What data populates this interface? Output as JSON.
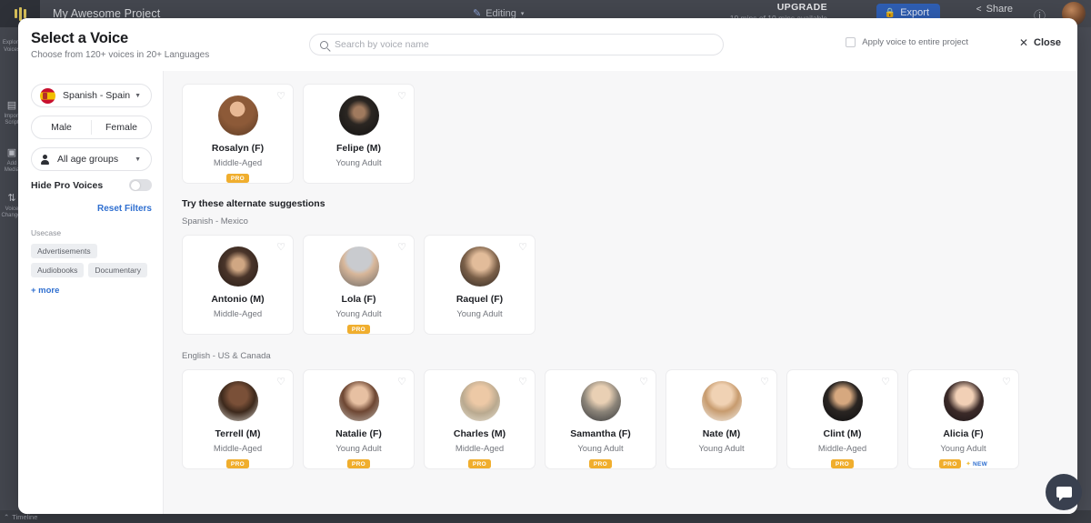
{
  "app": {
    "project_title": "My Awesome Project",
    "editing_label": "Editing",
    "upgrade_label": "UPGRADE",
    "upgrade_sub": "10 mins of 10 mins available",
    "export_label": "Export",
    "share_label": "Share",
    "timeline_label": "Timeline",
    "rail": [
      {
        "label": "Explore Voices",
        "icon": "avatar-icon"
      },
      {
        "label": "Import Script",
        "icon": "script-icon"
      },
      {
        "label": "Add Media",
        "icon": "media-icon"
      },
      {
        "label": "Voice Changer",
        "icon": "voice-changer-icon"
      }
    ]
  },
  "modal": {
    "title": "Select a Voice",
    "subtitle": "Choose from 120+ voices in 20+ Languages",
    "search_placeholder": "Search by voice name",
    "search_value": "",
    "apply_label": "Apply voice to entire project",
    "apply_checked": false,
    "close_label": "Close"
  },
  "sidebar": {
    "language": "Spanish - Spain",
    "gender_male": "Male",
    "gender_female": "Female",
    "age_group": "All age groups",
    "hide_pro_label": "Hide Pro Voices",
    "hide_pro_on": false,
    "reset_label": "Reset Filters",
    "usecase_title": "Usecase",
    "usecase_chips": [
      "Advertisements",
      "Audiobooks",
      "Documentary"
    ],
    "more_label": "+ more"
  },
  "content": {
    "primary": [
      {
        "name": "Rosalyn (F)",
        "age": "Middle-Aged",
        "pro": true,
        "new": false,
        "av": "rosalyn"
      },
      {
        "name": "Felipe (M)",
        "age": "Young Adult",
        "pro": false,
        "new": false,
        "av": "felipe"
      }
    ],
    "alt_title": "Try these alternate suggestions",
    "sections": [
      {
        "language": "Spanish - Mexico",
        "voices": [
          {
            "name": "Antonio (M)",
            "age": "Middle-Aged",
            "pro": false,
            "new": false,
            "av": "antonio"
          },
          {
            "name": "Lola (F)",
            "age": "Young Adult",
            "pro": true,
            "new": false,
            "av": "lola"
          },
          {
            "name": "Raquel (F)",
            "age": "Young Adult",
            "pro": false,
            "new": false,
            "av": "raquel"
          }
        ]
      },
      {
        "language": "English - US & Canada",
        "voices": [
          {
            "name": "Terrell (M)",
            "age": "Middle-Aged",
            "pro": true,
            "new": false,
            "av": "terrell"
          },
          {
            "name": "Natalie (F)",
            "age": "Young Adult",
            "pro": true,
            "new": false,
            "av": "natalie"
          },
          {
            "name": "Charles (M)",
            "age": "Middle-Aged",
            "pro": true,
            "new": false,
            "av": "charles"
          },
          {
            "name": "Samantha (F)",
            "age": "Young Adult",
            "pro": true,
            "new": false,
            "av": "samantha"
          },
          {
            "name": "Nate (M)",
            "age": "Young Adult",
            "pro": false,
            "new": false,
            "av": "nate"
          },
          {
            "name": "Clint (M)",
            "age": "Middle-Aged",
            "pro": true,
            "new": false,
            "av": "clint"
          },
          {
            "name": "Alicia (F)",
            "age": "Young Adult",
            "pro": true,
            "new": true,
            "av": "alicia"
          }
        ]
      }
    ],
    "pro_badge_label": "PRO",
    "new_badge_label": "NEW",
    "heart_icon": "♡"
  },
  "colors": {
    "accent_blue": "#2f6fd0",
    "pro_gold": "#f0ae2e",
    "export_blue": "#2f5fb5",
    "page_bg": "#f7f7f8"
  }
}
